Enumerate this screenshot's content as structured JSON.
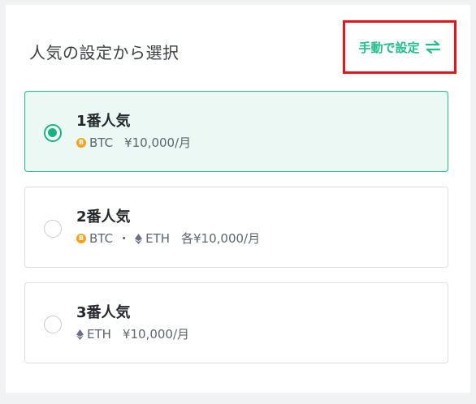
{
  "section": {
    "title": "人気の設定から選択",
    "manual_label": "手動で設定"
  },
  "options": [
    {
      "title": "1番人気",
      "coins": [
        "BTC"
      ],
      "amount": "¥10,000/月",
      "selected": true
    },
    {
      "title": "2番人気",
      "coins": [
        "BTC",
        "ETH"
      ],
      "separator": "・",
      "amount": "各¥10,000/月",
      "selected": false
    },
    {
      "title": "3番人気",
      "coins": [
        "ETH"
      ],
      "amount": "¥10,000/月",
      "selected": false
    }
  ],
  "icons": {
    "btc": "bitcoin-icon",
    "eth": "ethereum-icon",
    "swap": "swap-arrows-icon"
  },
  "colors": {
    "accent": "#1fbf88",
    "selected_bg": "#ebf8f3",
    "highlight_border": "#e8141a",
    "btc": "#f7a11a",
    "eth": "#6a6f88"
  }
}
